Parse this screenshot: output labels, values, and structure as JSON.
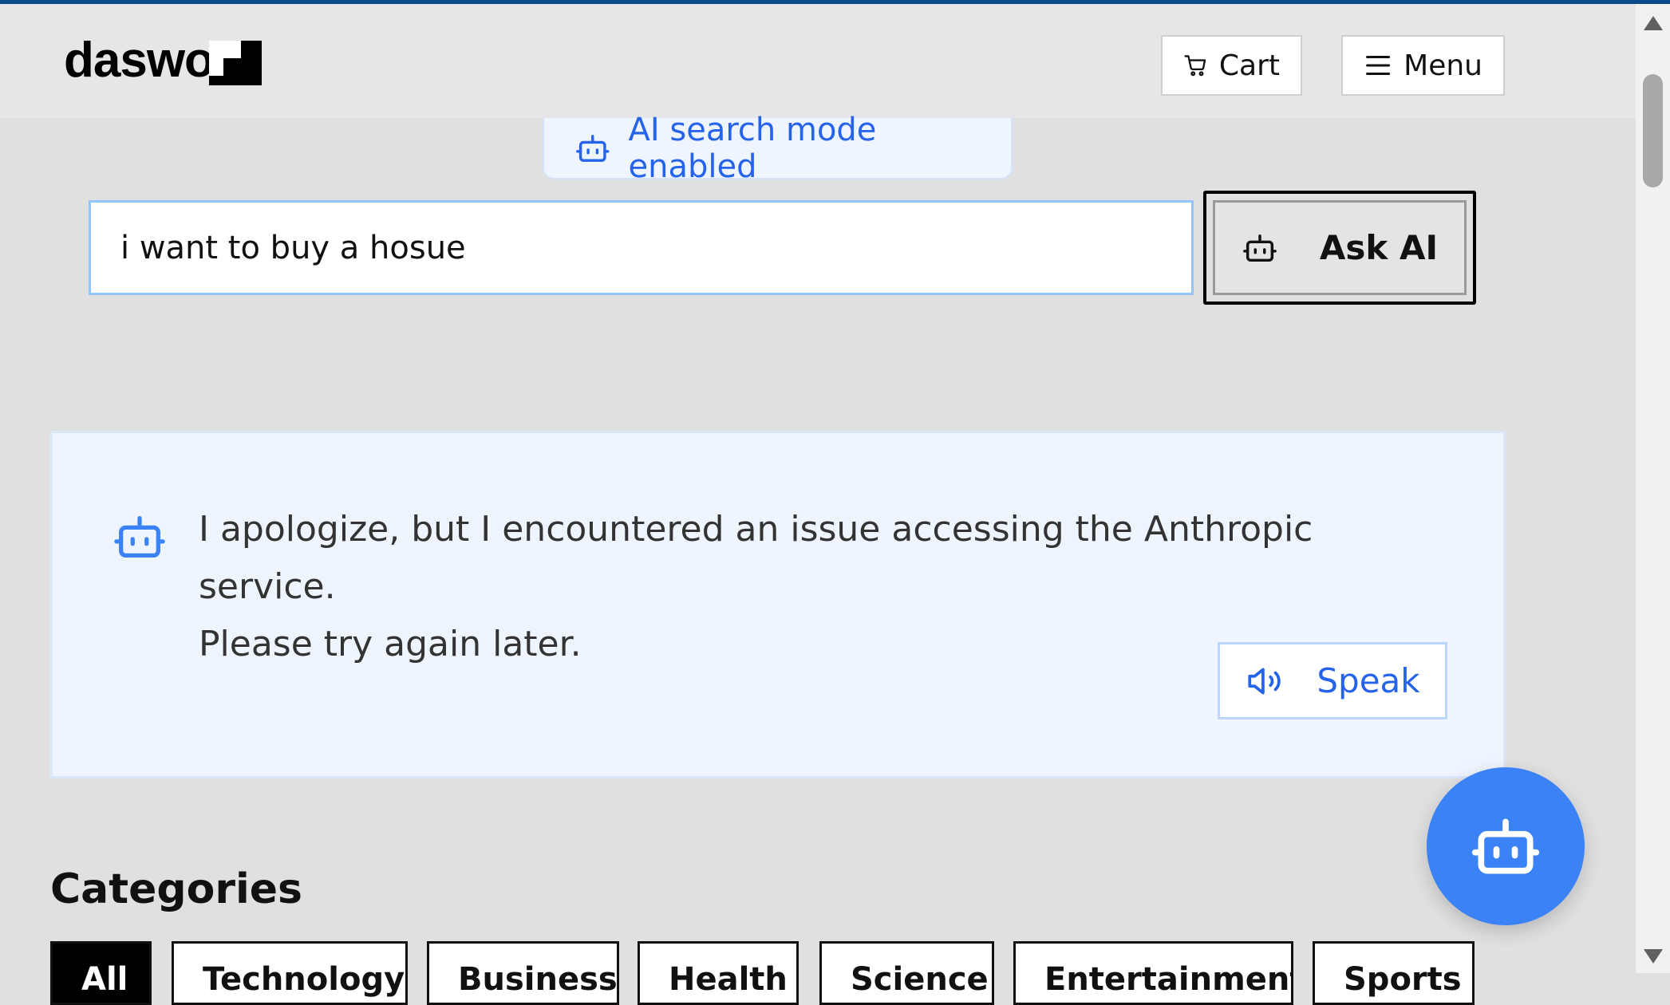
{
  "header": {
    "logo_text": "daswo",
    "cart_label": "Cart",
    "menu_label": "Menu"
  },
  "ai_banner": {
    "text": "AI search mode enabled",
    "icon": "robot-icon"
  },
  "search": {
    "value": "i want to buy a hosue",
    "button_label": "Ask AI",
    "button_icon": "robot-icon"
  },
  "response": {
    "icon": "robot-icon",
    "line1": "I apologize, but I encountered an issue accessing the Anthropic service.",
    "line2": "Please try again later.",
    "speak_label": "Speak",
    "speak_icon": "speaker-icon"
  },
  "categories": {
    "title": "Categories",
    "chips": [
      {
        "label": "All",
        "active": true
      },
      {
        "label": "Technology",
        "active": false
      },
      {
        "label": "Business",
        "active": false
      },
      {
        "label": "Health",
        "active": false
      },
      {
        "label": "Science",
        "active": false
      },
      {
        "label": "Entertainment",
        "active": false
      },
      {
        "label": "Sports",
        "active": false
      }
    ]
  },
  "floating_button": {
    "icon": "robot-icon"
  },
  "colors": {
    "accent": "#3b82f6",
    "accent_text": "#2563eb",
    "response_bg": "#eef5ff",
    "page_bg": "#e0e0e0"
  }
}
